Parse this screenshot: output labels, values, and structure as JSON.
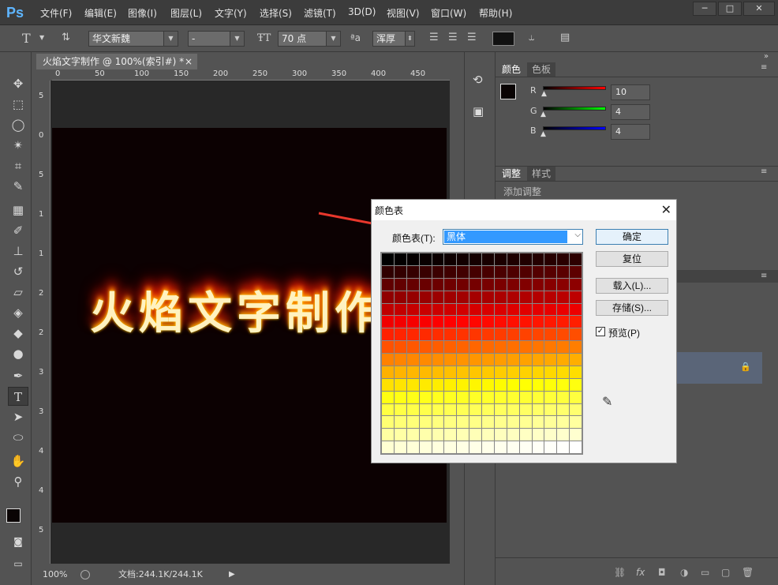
{
  "app": {
    "logo": "Ps"
  },
  "menu": [
    "文件(F)",
    "编辑(E)",
    "图像(I)",
    "图层(L)",
    "文字(Y)",
    "选择(S)",
    "滤镜(T)",
    "3D(D)",
    "视图(V)",
    "窗口(W)",
    "帮助(H)"
  ],
  "window_controls": {
    "minimize": "─",
    "restore": "□",
    "close": "✕"
  },
  "options": {
    "tool_icon": "T",
    "font_family": "华文新魏",
    "font_style": "-",
    "font_size": "70 点",
    "aa_icon": "ªa",
    "antialias": "浑厚"
  },
  "document": {
    "tab_title": "火焰文字制作 @ 100%(索引#) *",
    "tab_close": "×",
    "canvas_text": "火焰文字制作",
    "canvas_bg": "#0c0102",
    "ruler_h": [
      "0",
      "50",
      "100",
      "150",
      "200",
      "250",
      "300",
      "350",
      "400",
      "450"
    ],
    "ruler_v": [
      "5",
      "0",
      "5",
      "1",
      "1",
      "2",
      "2",
      "3",
      "3",
      "4",
      "4",
      "5"
    ]
  },
  "status": {
    "zoom": "100%",
    "doc_info": "文档:244.1K/244.1K"
  },
  "color_panel": {
    "tabs": [
      "颜色",
      "色板"
    ],
    "r_label": "R",
    "g_label": "G",
    "b_label": "B",
    "r": "10",
    "g": "4",
    "b": "4",
    "fg_color": "#0a0404",
    "bg_color": "#e60000"
  },
  "adjust_panel": {
    "tabs": [
      "调整",
      "样式"
    ],
    "add_label": "添加调整"
  },
  "dialog": {
    "title": "颜色表",
    "close": "✕",
    "table_label": "颜色表(T):",
    "table_value": "黑体",
    "ok": "确定",
    "reset": "复位",
    "load": "载入(L)...",
    "save": "存储(S)...",
    "preview_label": "预览(P)",
    "preview_checked": "☑"
  }
}
